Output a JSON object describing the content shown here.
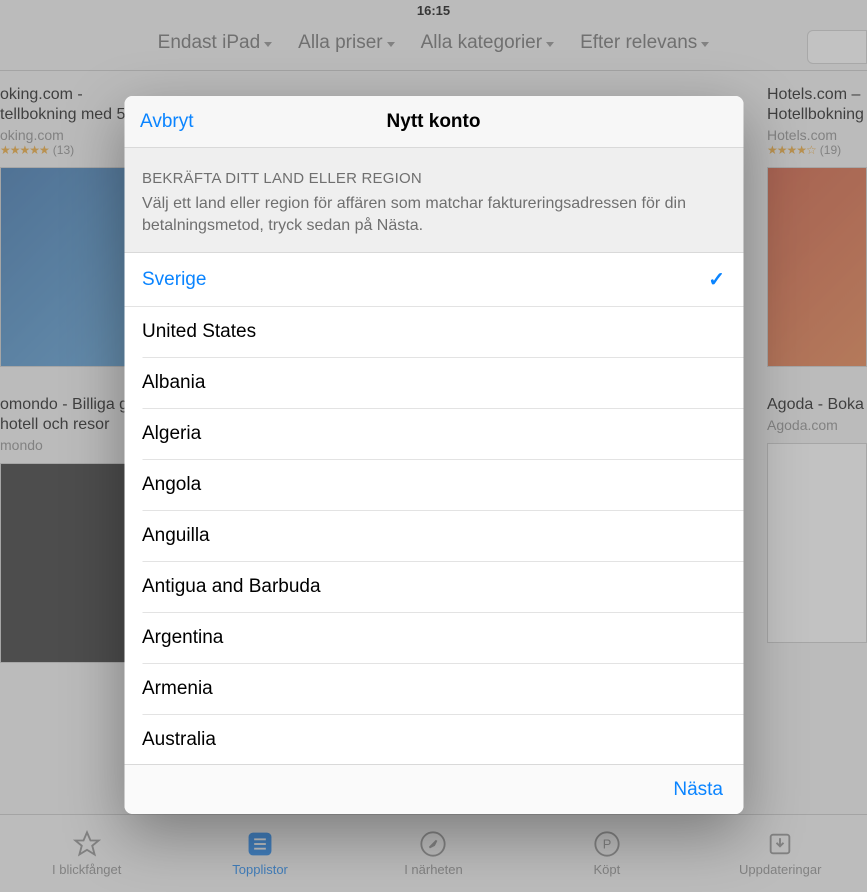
{
  "status": {
    "time": "16:15"
  },
  "filters": {
    "device": "Endast iPad",
    "price": "Alla priser",
    "category": "Alla kategorier",
    "sort": "Efter relevans"
  },
  "bg_apps": {
    "left1": {
      "title": "oking.com - tellbokning med 5.",
      "sub": "oking.com",
      "rating_count": "(13)"
    },
    "right1": {
      "title": "Hotels.com – Hotellbokning",
      "sub": "Hotels.com",
      "rating_count": "(19)"
    },
    "left2": {
      "title": "omondo - Billiga g, hotell och resor",
      "sub": "mondo"
    },
    "right2": {
      "title": "Agoda - Boka",
      "sub": "Agoda.com"
    }
  },
  "tabs": {
    "featured": "I blickfånget",
    "top": "Topplistor",
    "near": "I närheten",
    "purchased": "Köpt",
    "updates": "Uppdateringar"
  },
  "modal": {
    "cancel": "Avbryt",
    "title": "Nytt konto",
    "kicker": "BEKRÄFTA DITT LAND ELLER REGION",
    "desc": "Välj ett land eller region för affären som matchar faktureringsadressen för din betalningsmetod, tryck sedan på Nästa.",
    "next": "Nästa",
    "countries": [
      {
        "name": "Sverige",
        "selected": true
      },
      {
        "name": "United States",
        "selected": false
      },
      {
        "name": "Albania",
        "selected": false
      },
      {
        "name": "Algeria",
        "selected": false
      },
      {
        "name": "Angola",
        "selected": false
      },
      {
        "name": "Anguilla",
        "selected": false
      },
      {
        "name": "Antigua and Barbuda",
        "selected": false
      },
      {
        "name": "Argentina",
        "selected": false
      },
      {
        "name": "Armenia",
        "selected": false
      },
      {
        "name": "Australia",
        "selected": false
      }
    ]
  }
}
